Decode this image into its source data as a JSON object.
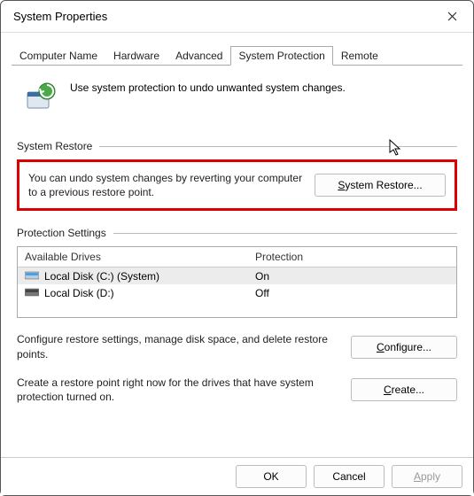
{
  "window": {
    "title": "System Properties"
  },
  "tabs": {
    "computer_name": "Computer Name",
    "hardware": "Hardware",
    "advanced": "Advanced",
    "system_protection": "System Protection",
    "remote": "Remote"
  },
  "intro": "Use system protection to undo unwanted system changes.",
  "sections": {
    "restore": {
      "title": "System Restore",
      "desc": "You can undo system changes by reverting your computer to a previous restore point.",
      "button_prefix": "S",
      "button_rest": "ystem Restore..."
    },
    "protection": {
      "title": "Protection Settings",
      "headers": {
        "drive": "Available Drives",
        "protection": "Protection"
      },
      "rows": [
        {
          "name": "Local Disk (C:) (System)",
          "protection": "On",
          "selected": true,
          "iconColor1": "#4aa0e8",
          "iconColor2": "#bcd"
        },
        {
          "name": "Local Disk (D:)",
          "protection": "Off",
          "selected": false,
          "iconColor1": "#444",
          "iconColor2": "#777"
        }
      ]
    },
    "configure": {
      "desc": "Configure restore settings, manage disk space, and delete restore points.",
      "button_prefix": "C",
      "button_rest": "onfigure..."
    },
    "create": {
      "desc": "Create a restore point right now for the drives that have system protection turned on.",
      "button_prefix": "C",
      "button_rest": "reate..."
    }
  },
  "buttons": {
    "ok": "OK",
    "cancel": "Cancel",
    "apply_prefix": "A",
    "apply_rest": "pply"
  }
}
